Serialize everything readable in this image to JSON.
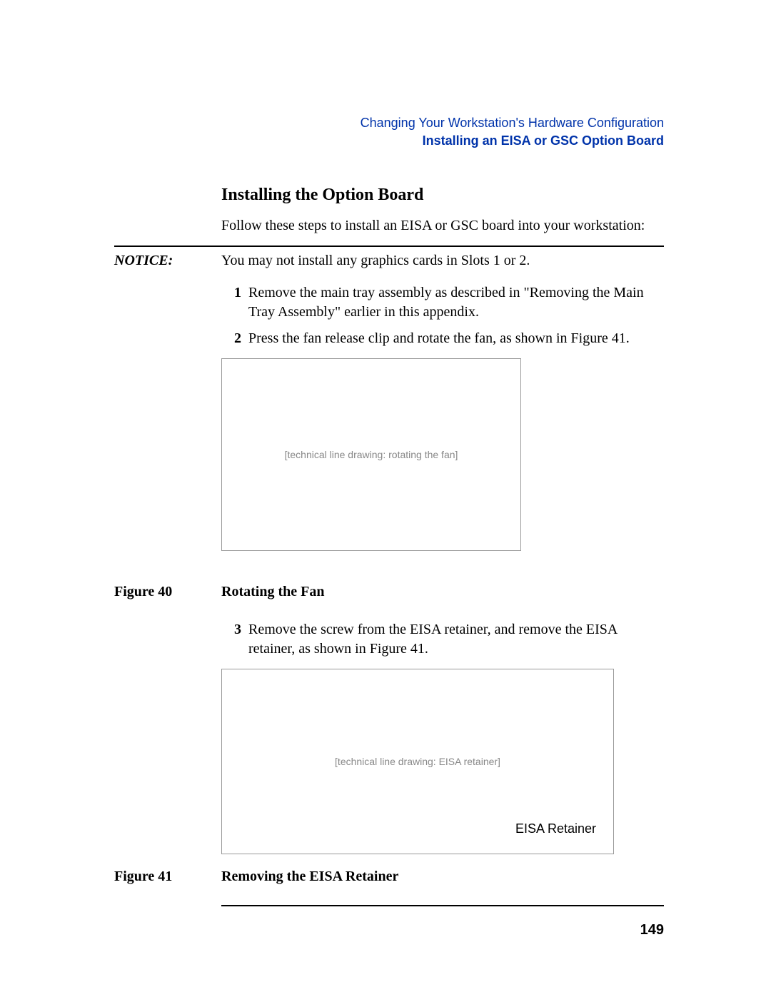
{
  "header": {
    "chapter": "Changing Your Workstation's Hardware Configuration",
    "section": "Installing an EISA or GSC Option Board"
  },
  "section_heading": "Installing the Option Board",
  "intro": "Follow these steps to install an EISA or GSC board into your workstation:",
  "notice": {
    "label": "NOTICE:",
    "text": "You may not install any graphics cards in Slots 1 or 2."
  },
  "steps": [
    {
      "num": "1",
      "text": "Remove the main tray assembly as described in \"Removing the Main Tray Assembly\" earlier in this appendix."
    },
    {
      "num": "2",
      "text": "Press the fan release clip and rotate the fan, as shown in Figure 41."
    },
    {
      "num": "3",
      "text": "Remove the screw from the EISA retainer, and remove the EISA retainer, as shown in Figure 41."
    }
  ],
  "figures": [
    {
      "label": "Figure 40",
      "title": "Rotating the Fan",
      "placeholder": "[technical line drawing: rotating the fan]"
    },
    {
      "label": "Figure 41",
      "title": "Removing the EISA Retainer",
      "placeholder": "[technical line drawing: EISA retainer]",
      "callout": "EISA Retainer"
    }
  ],
  "page_number": "149"
}
